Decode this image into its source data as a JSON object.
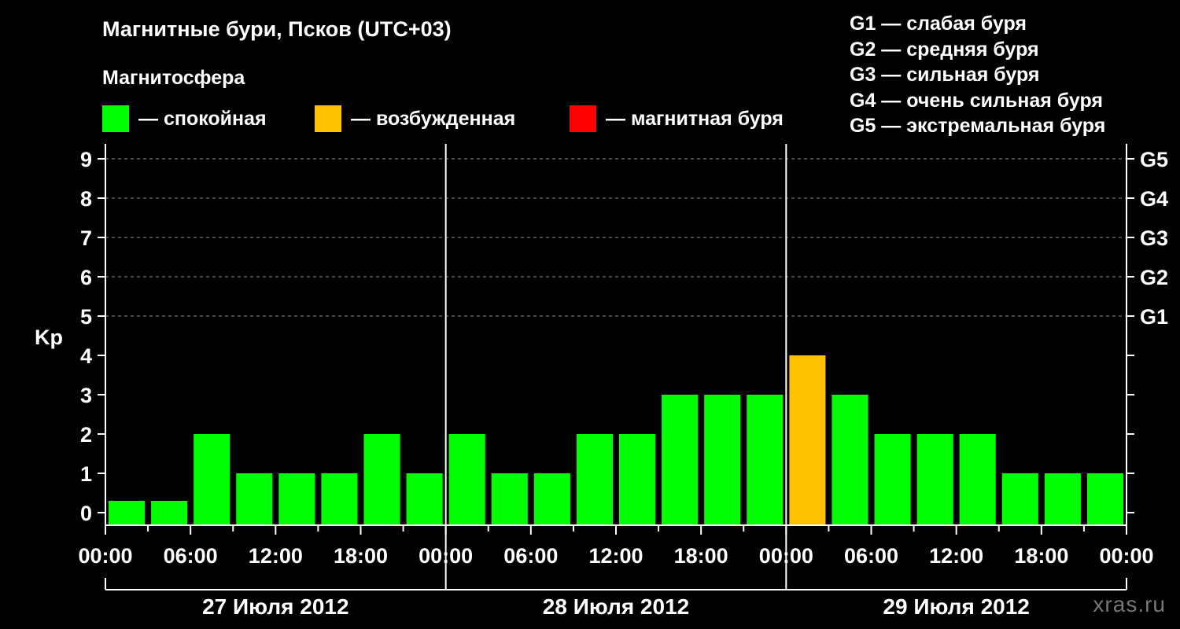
{
  "header": {
    "title": "Магнитные бури, Псков (UTC+03)",
    "subtitle": "Магнитосфера"
  },
  "legend": [
    {
      "label": "— спокойная",
      "color": "#00ff00"
    },
    {
      "label": "— возбужденная",
      "color": "#ffc000"
    },
    {
      "label": "— магнитная буря",
      "color": "#ff0000"
    }
  ],
  "g_scale": [
    "G1 — слабая буря",
    "G2 — средняя буря",
    "G3 — сильная буря",
    "G4 — очень сильная буря",
    "G5 — экстремальная буря"
  ],
  "watermark": "xras.ru",
  "chart_data": {
    "type": "bar",
    "ylabel": "Kp",
    "ylim": [
      0,
      9
    ],
    "y_ticks": [
      "0",
      "1",
      "2",
      "3",
      "4",
      "5",
      "6",
      "7",
      "8",
      "9"
    ],
    "right_axis_labels": [
      {
        "kp": 5,
        "label": "G1"
      },
      {
        "kp": 6,
        "label": "G2"
      },
      {
        "kp": 7,
        "label": "G3"
      },
      {
        "kp": 8,
        "label": "G4"
      },
      {
        "kp": 9,
        "label": "G5"
      }
    ],
    "x_tick_labels": [
      "00:00",
      "06:00",
      "12:00",
      "18:00",
      "00:00",
      "06:00",
      "12:00",
      "18:00",
      "00:00",
      "06:00",
      "12:00",
      "18:00",
      "00:00"
    ],
    "days": [
      "27 Июля 2012",
      "28 Июля 2012",
      "29 Июля 2012"
    ],
    "interval_hours": 3,
    "grid": "dashed horizontal at Kp 5-9",
    "values": [
      0,
      0,
      2,
      1,
      1,
      1,
      2,
      1,
      2,
      1,
      1,
      2,
      2,
      3,
      3,
      3,
      4,
      3,
      2,
      2,
      2,
      1,
      1,
      1
    ],
    "colors": {
      "quiet": "#00ff00",
      "unsettled": "#ffc000",
      "storm": "#ff0000"
    }
  }
}
